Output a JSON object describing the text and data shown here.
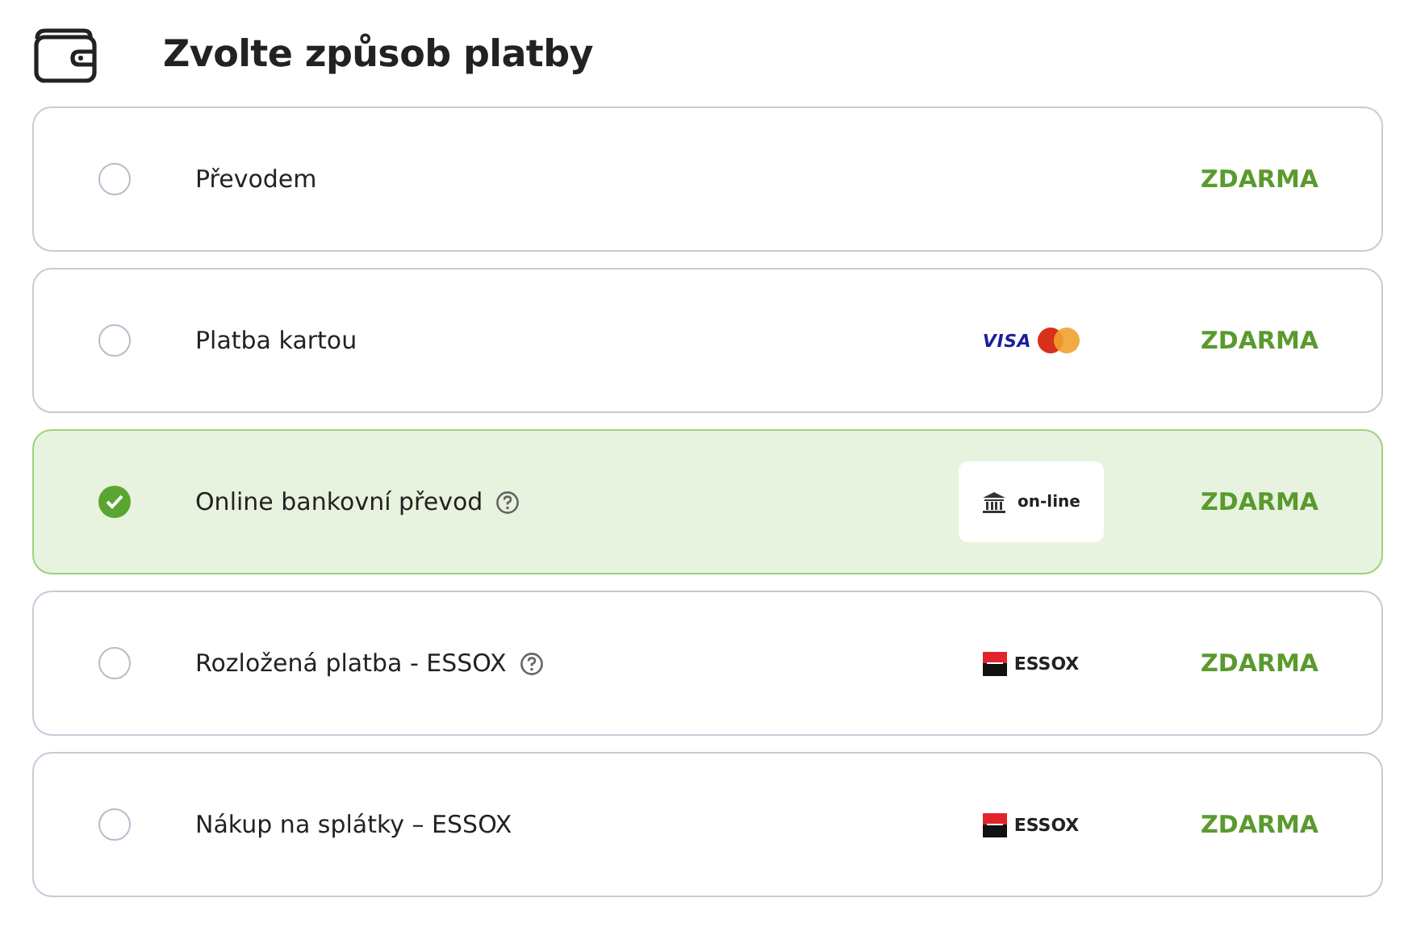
{
  "title": "Zvolte způsob platby",
  "options": [
    {
      "label": "Převodem",
      "selected": false,
      "help": false,
      "price": "ZDARMA"
    },
    {
      "label": "Platba kartou",
      "selected": false,
      "help": false,
      "logo": {
        "kind": "cards",
        "text": "VISA"
      },
      "price": "ZDARMA"
    },
    {
      "label": "Online bankovní převod",
      "selected": true,
      "help": true,
      "logo": {
        "kind": "bank",
        "text": "on-line"
      },
      "price": "ZDARMA"
    },
    {
      "label": "Rozložená platba - ESSOX",
      "selected": false,
      "help": true,
      "logo": {
        "kind": "essox",
        "text": "ESSOX"
      },
      "price": "ZDARMA"
    },
    {
      "label": "Nákup na splátky – ESSOX",
      "selected": false,
      "help": false,
      "logo": {
        "kind": "essox",
        "text": "ESSOX"
      },
      "price": "ZDARMA"
    }
  ]
}
